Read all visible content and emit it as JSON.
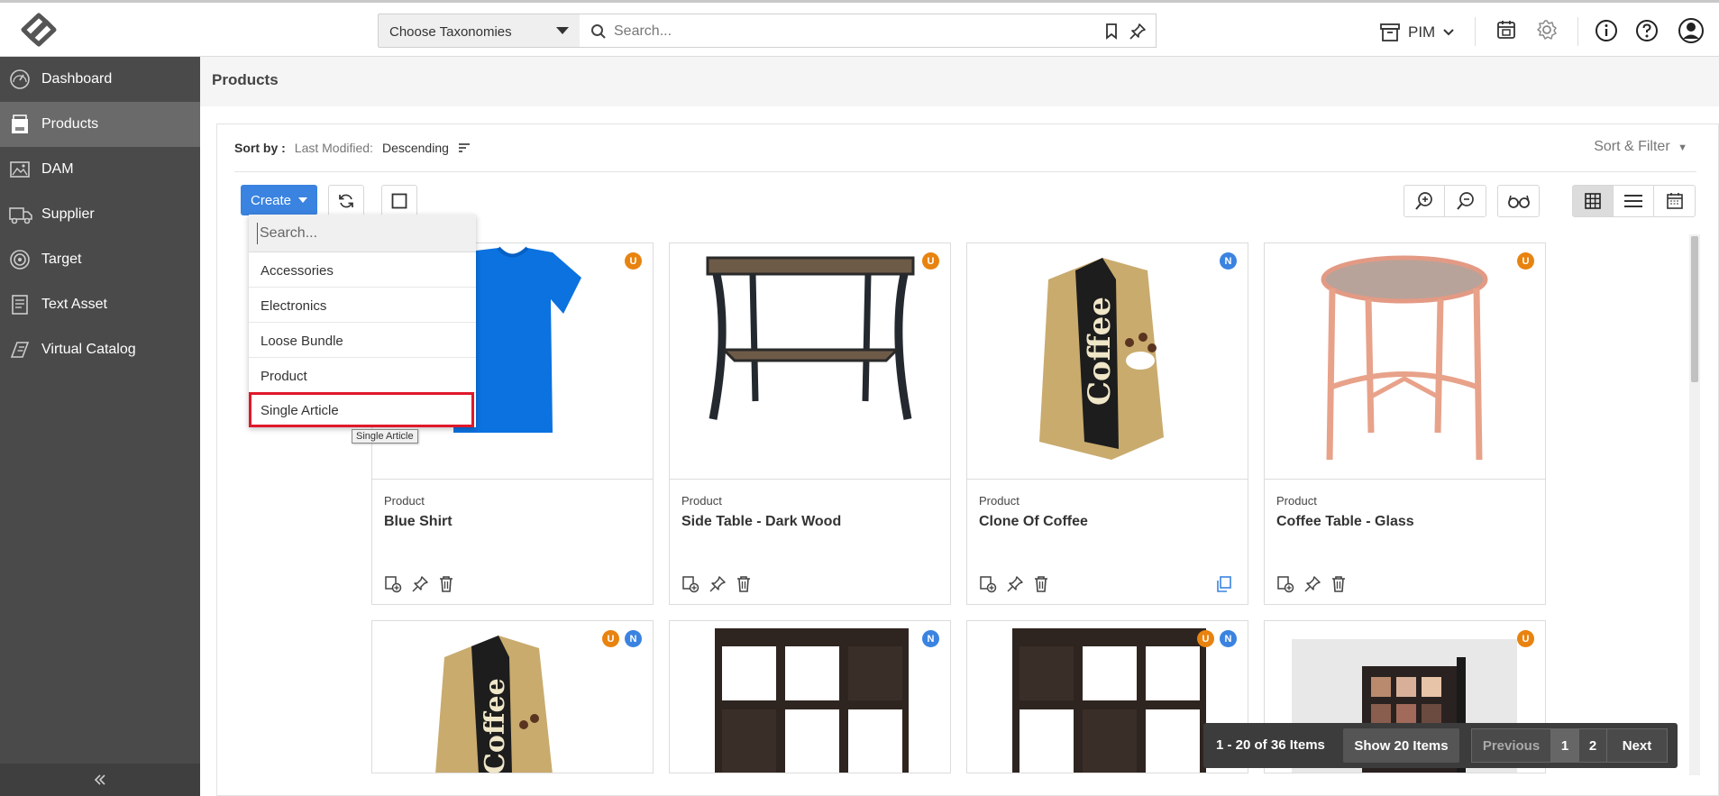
{
  "header": {
    "taxonomy_select": "Choose Taxonomies",
    "search_placeholder": "Search...",
    "module_switch": "PIM"
  },
  "sidebar": {
    "items": [
      {
        "label": "Dashboard",
        "icon": "dashboard-gauge-icon"
      },
      {
        "label": "Products",
        "icon": "products-box-icon",
        "active": true
      },
      {
        "label": "DAM",
        "icon": "image-icon"
      },
      {
        "label": "Supplier",
        "icon": "truck-icon"
      },
      {
        "label": "Target",
        "icon": "target-icon"
      },
      {
        "label": "Text Asset",
        "icon": "document-icon"
      },
      {
        "label": "Virtual Catalog",
        "icon": "catalog-icon"
      }
    ]
  },
  "page": {
    "title": "Products"
  },
  "sort": {
    "label": "Sort by :",
    "field": "Last Modified:",
    "direction": "Descending",
    "sort_filter": "Sort & Filter"
  },
  "toolbar": {
    "create_label": "Create"
  },
  "create_dropdown": {
    "search_placeholder": "Search...",
    "items": [
      "Accessories",
      "Electronics",
      "Loose Bundle",
      "Product",
      "Single Article"
    ],
    "highlighted": "Single Article",
    "tooltip": "Single Article"
  },
  "products": [
    {
      "type": "Product",
      "name": "Blue Shirt",
      "badges": [
        "U"
      ],
      "image": "blue-tshirt"
    },
    {
      "type": "Product",
      "name": "Side Table - Dark Wood",
      "badges": [
        "U"
      ],
      "image": "side-table"
    },
    {
      "type": "Product",
      "name": "Clone Of Coffee",
      "badges": [
        "N"
      ],
      "image": "coffee-bag"
    },
    {
      "type": "Product",
      "name": "Coffee Table - Glass",
      "badges": [
        "U"
      ],
      "image": "glass-table"
    }
  ],
  "products_row2": [
    {
      "badges": [
        "U",
        "N"
      ],
      "image": "coffee-bag"
    },
    {
      "badges": [
        "N"
      ],
      "image": "cube-shelf"
    },
    {
      "badges": [
        "U",
        "N"
      ],
      "image": "cube-shelf"
    },
    {
      "badges": [
        "U"
      ],
      "image": "eyeshadow-palette"
    }
  ],
  "pagination": {
    "summary": "1 - 20 of 36 Items",
    "show": "Show 20 Items",
    "previous": "Previous",
    "pages": [
      "1",
      "2"
    ],
    "current_page": "1",
    "next": "Next"
  },
  "colors": {
    "accent": "#3a83e0",
    "sidebar": "#4a4a4a",
    "badge_u": "#e8830f",
    "badge_n": "#3a83e0",
    "highlight": "#e0182b"
  }
}
